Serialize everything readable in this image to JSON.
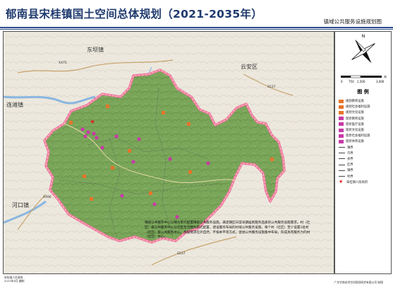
{
  "header": {
    "title": "郁南县宋桂镇国土空间总体规划（2021-2035年）",
    "subtitle": "镇域公共服务设施规划图"
  },
  "map": {
    "places": {
      "dongba": "东坝镇",
      "yunan_district": "云安区",
      "lianjiang": "连滩镇",
      "hekou": "河口镇"
    },
    "roads": {
      "x475": "X475",
      "s537_top": "S537",
      "x490": "X490",
      "s537_bottom": "S537"
    }
  },
  "north_arrow": {
    "label": "N"
  },
  "scale": {
    "ticks": [
      "0",
      "750",
      "1,500",
      "3,000"
    ],
    "unit": "米"
  },
  "legend": {
    "title": "图  例",
    "items": [
      {
        "label": "规划教育设施",
        "kind": "swatch",
        "color": "#e8742a"
      },
      {
        "label": "规划社会福利设施",
        "kind": "swatch",
        "color": "#e8742a"
      },
      {
        "label": "规划文化设施",
        "kind": "swatch",
        "color": "#e8742a"
      },
      {
        "label": "现状教育设施",
        "kind": "swatch",
        "color": "#c73aa5"
      },
      {
        "label": "现状医疗设施",
        "kind": "swatch",
        "color": "#c73aa5"
      },
      {
        "label": "现状文化设施",
        "kind": "swatch",
        "color": "#c73aa5"
      },
      {
        "label": "现状社会福利设施",
        "kind": "swatch",
        "color": "#c73aa5"
      },
      {
        "label": "现状体育设施",
        "kind": "swatch",
        "color": "#c73aa5"
      },
      {
        "label": "镇界",
        "kind": "line"
      },
      {
        "label": "市界",
        "kind": "line"
      },
      {
        "label": "县界",
        "kind": "line"
      },
      {
        "label": "区界",
        "kind": "line"
      },
      {
        "label": "镇界",
        "kind": "line"
      },
      {
        "label": "村界",
        "kind": "line"
      },
      {
        "label": "宋桂镇人民政府",
        "kind": "star"
      }
    ]
  },
  "note": "镇级公共服务中心以镇为单元配置镇级公共服务设施，满足镇区日常早期居民服务品质的公共服务设施需求。村（社区）级公共服务中心以社区生活圈为单元配置，建设服务布局的村域公共服务设施，每个村（社区）至少设置1处村（社区）级公共服务中心，根据需求在外自然，不按本平等方式。促进公共服务设施集中布局，形成具有服务力的村（社区）中心。",
  "footer": {
    "left_line1": "宋桂镇人民政府",
    "left_line2": "2023年6月   编制",
    "right": "广东华南技术空间规划研究有限公司  制图"
  },
  "colors": {
    "title": "#1f3a6e",
    "boundary": "#f0789a",
    "terrain": "#7da85c",
    "planned": "#e8742a",
    "existing": "#c73aa5"
  }
}
